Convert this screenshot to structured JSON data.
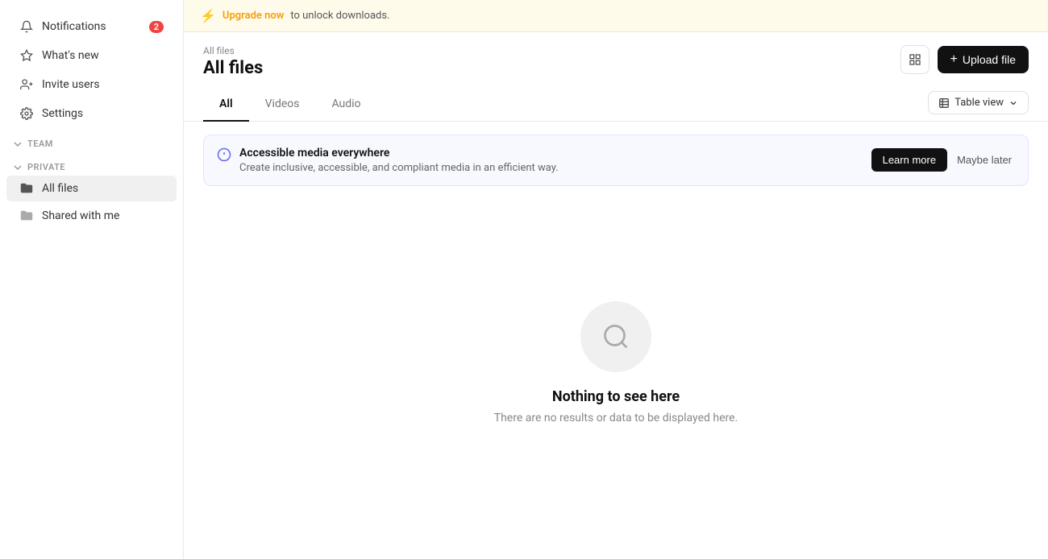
{
  "upgrade_banner": {
    "link_text": "Upgrade now",
    "message": " to unlock downloads."
  },
  "sidebar": {
    "nav_items": [
      {
        "id": "notifications",
        "label": "Notifications",
        "badge": "2",
        "icon": "bell"
      },
      {
        "id": "whats-new",
        "label": "What's new",
        "icon": "sparkle"
      },
      {
        "id": "invite-users",
        "label": "Invite users",
        "icon": "person-add"
      },
      {
        "id": "settings",
        "label": "Settings",
        "icon": "gear"
      }
    ],
    "sections": [
      {
        "label": "TEAM",
        "items": []
      },
      {
        "label": "PRIVATE",
        "items": [
          {
            "id": "all-files",
            "label": "All files",
            "active": true
          },
          {
            "id": "shared-with-me",
            "label": "Shared with me",
            "active": false
          }
        ]
      }
    ]
  },
  "header": {
    "breadcrumb": "All files",
    "title": "All files",
    "upload_button": "Upload file"
  },
  "tabs": [
    {
      "id": "all",
      "label": "All",
      "active": true
    },
    {
      "id": "videos",
      "label": "Videos",
      "active": false
    },
    {
      "id": "audio",
      "label": "Audio",
      "active": false
    }
  ],
  "view_toggle": {
    "label": "Table view",
    "icon": "table-icon"
  },
  "info_banner": {
    "title": "Accessible media everywhere",
    "description": "Create inclusive, accessible, and compliant media in an efficient way.",
    "learn_more": "Learn more",
    "maybe_later": "Maybe later"
  },
  "empty_state": {
    "title": "Nothing to see here",
    "description": "There are no results or data to be displayed here."
  }
}
